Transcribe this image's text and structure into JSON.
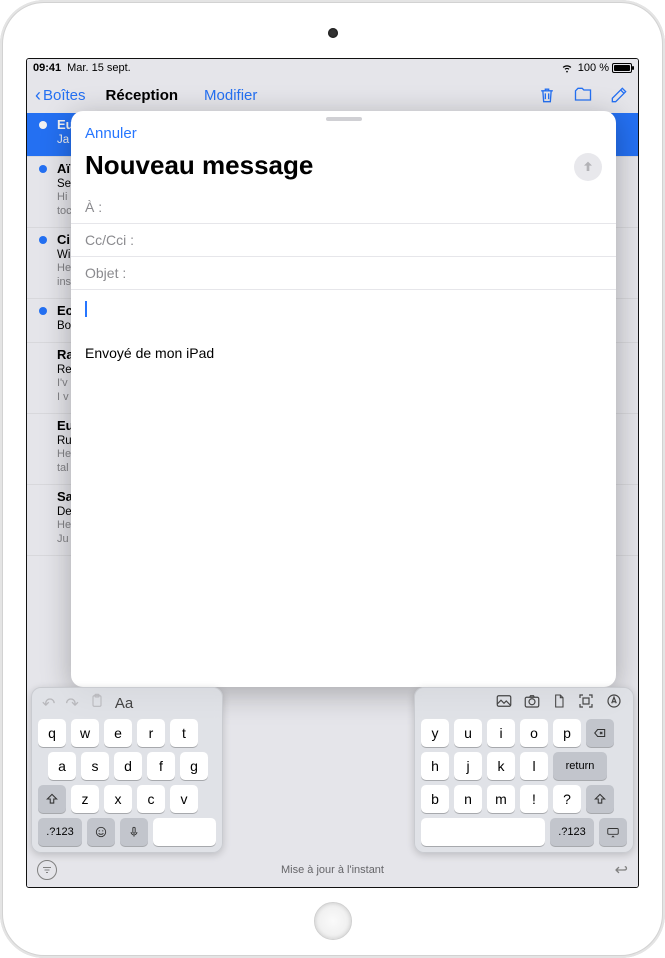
{
  "status": {
    "time": "09:41",
    "date": "Mar. 15 sept.",
    "battery_pct": "100 %",
    "wifi_icon": "wifi"
  },
  "toolbar": {
    "back_label": "Boîtes",
    "inbox_title": "Réception",
    "modify_label": "Modifier"
  },
  "icons": {
    "trash": "trash",
    "folder": "folder",
    "compose": "compose"
  },
  "mail_list": [
    {
      "sender": "Eu",
      "subject": "Ja",
      "preview": "",
      "selected": true,
      "unread": true
    },
    {
      "sender": "Aï",
      "subject": "Se",
      "preview": "Hi\ntoc",
      "unread": true
    },
    {
      "sender": "Ci",
      "subject": "Wi",
      "preview": "He\nins",
      "unread": true
    },
    {
      "sender": "Ec",
      "subject": "Bo",
      "preview": "",
      "unread": true
    },
    {
      "sender": "Ra",
      "subject": "Re",
      "preview": "I'v\nI v",
      "unread": false
    },
    {
      "sender": "Eu",
      "subject": "Ru",
      "preview": "He\ntal",
      "unread": false
    },
    {
      "sender": "Sa",
      "subject": "De",
      "preview": "He\nJu",
      "unread": false
    }
  ],
  "bottom": {
    "updated_label": "Mise à jour à l'instant"
  },
  "compose": {
    "cancel_label": "Annuler",
    "title": "Nouveau message",
    "to_label": "À :",
    "cc_label": "Cc/Cci :",
    "subject_label": "Objet :",
    "to_value": "",
    "cc_value": "",
    "subject_value": "",
    "body_value": "",
    "signature": "Envoyé de mon iPad"
  },
  "keyboard": {
    "left": {
      "toolbar": [
        "undo",
        "redo",
        "clipboard",
        "Aa"
      ],
      "rows": [
        [
          "q",
          "w",
          "e",
          "r",
          "t"
        ],
        [
          "a",
          "s",
          "d",
          "f",
          "g"
        ],
        [
          "shift",
          "z",
          "x",
          "c",
          "v"
        ],
        [
          ".?123",
          "emoji",
          "mic",
          "space"
        ]
      ]
    },
    "right": {
      "toolbar": [
        "photos",
        "camera",
        "doc",
        "scan",
        "markup"
      ],
      "rows": [
        [
          "y",
          "u",
          "i",
          "o",
          "p",
          "backspace"
        ],
        [
          "h",
          "j",
          "k",
          "l",
          "return"
        ],
        [
          "b",
          "n",
          "m",
          "!",
          "?",
          "shift"
        ],
        [
          "space",
          ".?123",
          "keyboard"
        ]
      ]
    },
    "return_label": "return",
    "numsym_label": ".?123"
  }
}
